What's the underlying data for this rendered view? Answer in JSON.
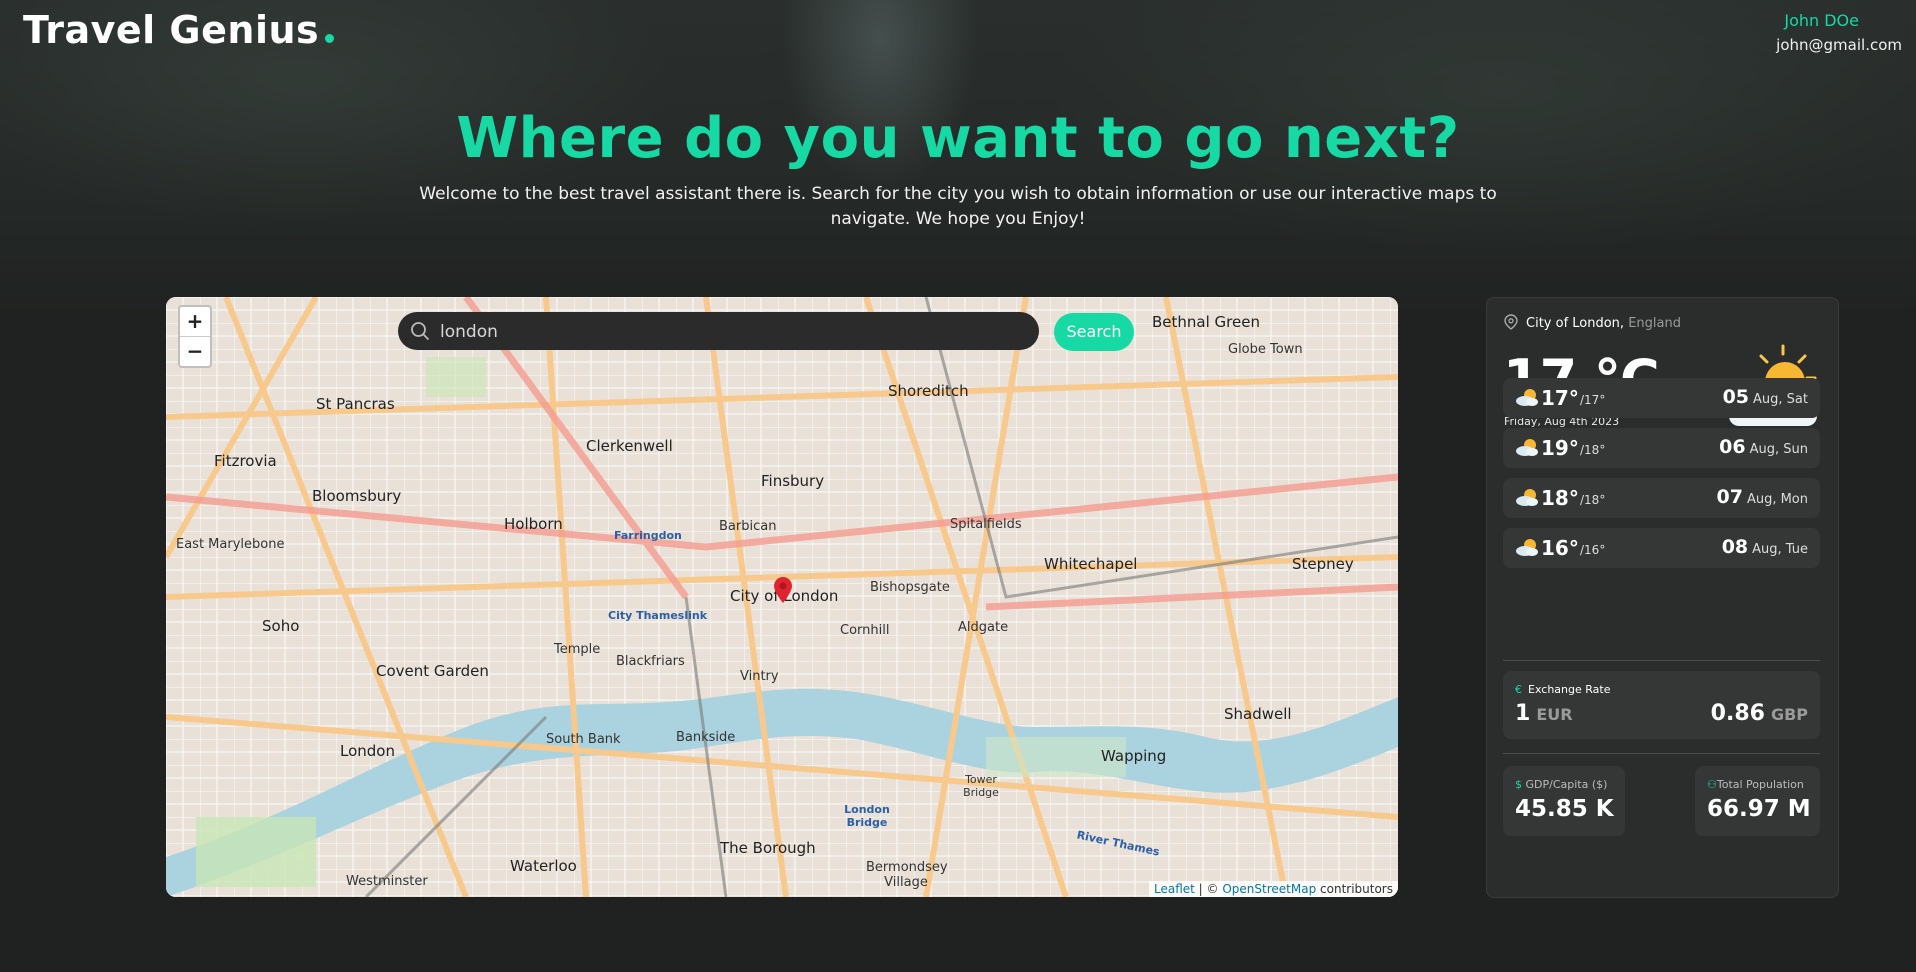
{
  "header": {
    "logo": "Travel Genius",
    "user_name": "John DOe",
    "user_email": "john@gmail.com"
  },
  "hero": {
    "headline": "Where do you want to go next?",
    "subline": "Welcome to the best travel assistant there is. Search for the city you wish to obtain information or use our interactive maps to navigate. We hope you Enjoy!"
  },
  "search": {
    "value": "london",
    "button": "Search"
  },
  "map": {
    "zoom_in": "+",
    "zoom_out": "−",
    "attribution_leaflet": "Leaflet",
    "attribution_sep": " | © ",
    "attribution_osm": "OpenStreetMap",
    "attribution_tail": " contributors",
    "labels": {
      "city_of_london": "City of London",
      "shoreditch": "Shoreditch",
      "clerkenwell": "Clerkenwell",
      "finsbury": "Finsbury",
      "barbican": "Barbican",
      "holborn": "Holborn",
      "bloomsbury": "Bloomsbury",
      "fitzrovia": "Fitzrovia",
      "st_pancras": "St Pancras",
      "soho": "Soho",
      "covent_garden": "Covent Garden",
      "london": "London",
      "whitechapel": "Whitechapel",
      "wapping": "Wapping",
      "shadwell": "Shadwell",
      "bethnal_green": "Bethnal Green",
      "globe_town": "Globe Town",
      "stepney": "Stepney",
      "bankside": "Bankside",
      "south_bank": "South Bank",
      "the_borough": "The Borough",
      "spitalfields": "Spitalfields",
      "bishopsgate": "Bishopsgate",
      "aldgate": "Aldgate",
      "temple": "Temple",
      "blackfriars": "Blackfriars",
      "vintry": "Vintry",
      "cornhill": "Cornhill",
      "waterloo": "Waterloo",
      "westminster": "Westminster",
      "bermondsey_village": "Bermondsey Village",
      "east_marylebone": "East Marylebone",
      "farringdon": "Farringdon",
      "city_thameslink": "City Thameslink",
      "london_bridge": "London Bridge",
      "tower_bridge": "Tower Bridge",
      "river_thames": "River Thames"
    }
  },
  "weather": {
    "city": "City of London,",
    "region": "England",
    "temp": "17 °C",
    "date": "Friday, Aug 4th 2023",
    "forecast": [
      {
        "hi": "17°",
        "lo": "/17°",
        "day": "05",
        "dow": "Aug, Sat"
      },
      {
        "hi": "19°",
        "lo": "/18°",
        "day": "06",
        "dow": "Aug, Sun"
      },
      {
        "hi": "18°",
        "lo": "/18°",
        "day": "07",
        "dow": "Aug, Mon"
      },
      {
        "hi": "16°",
        "lo": "/16°",
        "day": "08",
        "dow": "Aug, Tue"
      }
    ],
    "exchange": {
      "title": "Exchange Rate",
      "symbol": "€",
      "from_amount": "1",
      "from_cur": "EUR",
      "to_amount": "0.86",
      "to_cur": "GBP"
    },
    "gdp": {
      "label": "GDP/Capita ($)",
      "value": "45.85 K"
    },
    "population": {
      "label": "Total Population",
      "value": "66.97 M"
    }
  },
  "colors": {
    "accent": "#17d9a4",
    "panel": "#2b2c2c",
    "card": "#353636"
  }
}
